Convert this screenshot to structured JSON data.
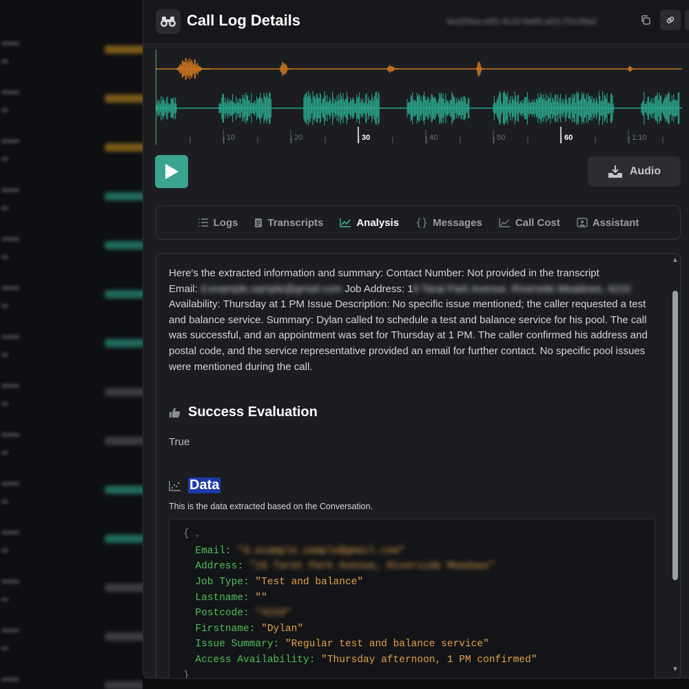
{
  "header": {
    "title": "Call Log Details",
    "call_id": "4ea2f3ea-e8f1-4c10-9a56-a01c7f1e39a2"
  },
  "waveform": {
    "time_labels": [
      "10",
      "20",
      "30",
      "40",
      "50",
      "60",
      "1:10"
    ],
    "bold_labels": [
      "30",
      "60"
    ],
    "colors": {
      "top_track": "#c97520",
      "bottom_track": "#2aa58a",
      "cursor": "#7fe07f"
    }
  },
  "audio_button": {
    "label": "Audio"
  },
  "tabs": [
    {
      "label": "Logs",
      "icon": "list-icon",
      "active": false
    },
    {
      "label": "Transcripts",
      "icon": "document-icon",
      "active": false
    },
    {
      "label": "Analysis",
      "icon": "chart-line-icon",
      "active": true
    },
    {
      "label": "Messages",
      "icon": "braces-icon",
      "active": false
    },
    {
      "label": "Call Cost",
      "icon": "chart-area-icon",
      "active": false
    },
    {
      "label": "Assistant",
      "icon": "assistant-icon",
      "active": false
    }
  ],
  "analysis": {
    "summary_line1": "Here's the extracted information and summary: Contact Number: Not provided in the transcript",
    "summary_email_label": "Email: ",
    "summary_email_value": "d.example.sample@gmail.com",
    "summary_address_label": " Job Address: 1",
    "summary_address_value": "6 Tarat Park Avenue, Riverside Meadows, 4210",
    "summary_rest": "Availability: Thursday at 1 PM Issue Description: No specific issue mentioned; the caller requested a test and balance service. Summary: Dylan called to schedule a test and balance service for his pool. The call was successful, and an appointment was set for Thursday at 1 PM. The caller confirmed his address and postal code, and the service representative provided an email for further contact. No specific pool issues were mentioned during the call.",
    "success_title": "Success Evaluation",
    "success_value": "True",
    "data_title": "Data",
    "data_description": "This is the data extracted based on the Conversation.",
    "data_fields": [
      {
        "key": "Email",
        "value": "\"d.example.sample@gmail.com\"",
        "redacted": true
      },
      {
        "key": "Address",
        "value": "\"16 Tarat Park Avenue, Riverside Meadows\"",
        "redacted": true
      },
      {
        "key": "Job Type",
        "value": "\"Test and balance\"",
        "redacted": false
      },
      {
        "key": "Lastname",
        "value": "\"\"",
        "redacted": false
      },
      {
        "key": "Postcode",
        "value": "\"4210\"",
        "redacted": true
      },
      {
        "key": "Firstname",
        "value": "\"Dylan\"",
        "redacted": false
      },
      {
        "key": "Issue Summary",
        "value": "\"Regular test and balance service\"",
        "redacted": false
      },
      {
        "key": "Access Availability",
        "value": "\"Thursday afternoon, 1 PM confirmed\"",
        "redacted": false
      }
    ]
  }
}
